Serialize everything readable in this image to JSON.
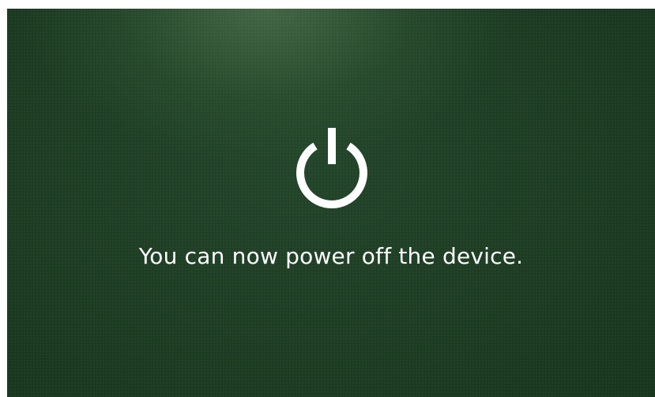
{
  "screen": {
    "message": "You can now power off the device.",
    "icon": "power-icon"
  },
  "colors": {
    "background": "#1c3b22",
    "highlight": "#5f875f",
    "foreground": "#ffffff"
  }
}
